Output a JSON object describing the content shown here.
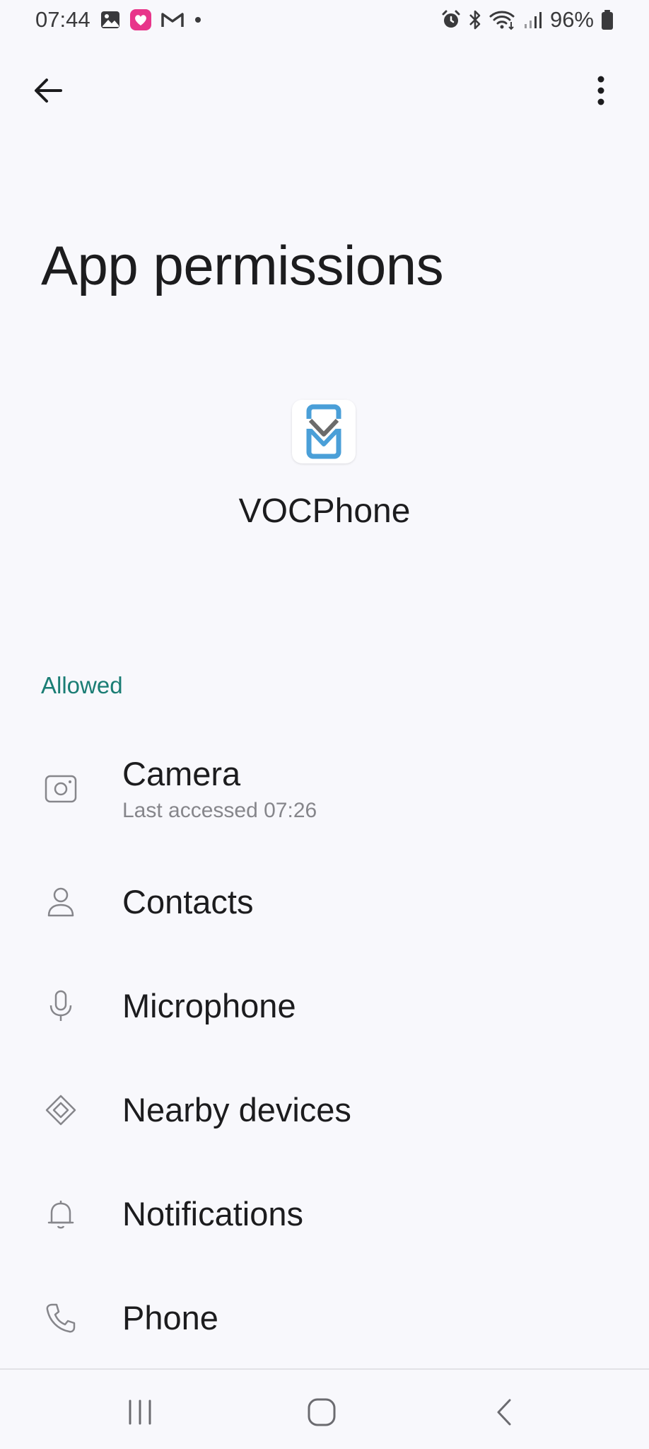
{
  "status_bar": {
    "time": "07:44",
    "battery": "96%",
    "left_icons": [
      "gallery-icon",
      "lux-icon",
      "gmail-icon",
      "dot-icon"
    ],
    "right_icons": [
      "alarm-icon",
      "bluetooth-icon",
      "wifi-icon",
      "signal-icon",
      "battery-icon"
    ]
  },
  "top_bar": {
    "back_icon": "arrow-left-icon",
    "more_icon": "more-vertical-icon"
  },
  "page": {
    "title": "App permissions"
  },
  "app": {
    "name": "VOCPhone",
    "icon": "vocphone-app-icon",
    "accent": "#4a9fd8"
  },
  "section": {
    "header": "Allowed",
    "header_color": "#1a7d74"
  },
  "permissions": [
    {
      "label": "Camera",
      "sub": "Last accessed 07:26",
      "icon": "camera-icon"
    },
    {
      "label": "Contacts",
      "sub": "",
      "icon": "person-icon"
    },
    {
      "label": "Microphone",
      "sub": "",
      "icon": "microphone-icon"
    },
    {
      "label": "Nearby devices",
      "sub": "",
      "icon": "nearby-devices-icon"
    },
    {
      "label": "Notifications",
      "sub": "",
      "icon": "bell-icon"
    },
    {
      "label": "Phone",
      "sub": "",
      "icon": "phone-icon"
    }
  ],
  "nav_bar": {
    "recents_icon": "recents-icon",
    "home_icon": "home-icon",
    "back_icon": "nav-back-icon"
  }
}
